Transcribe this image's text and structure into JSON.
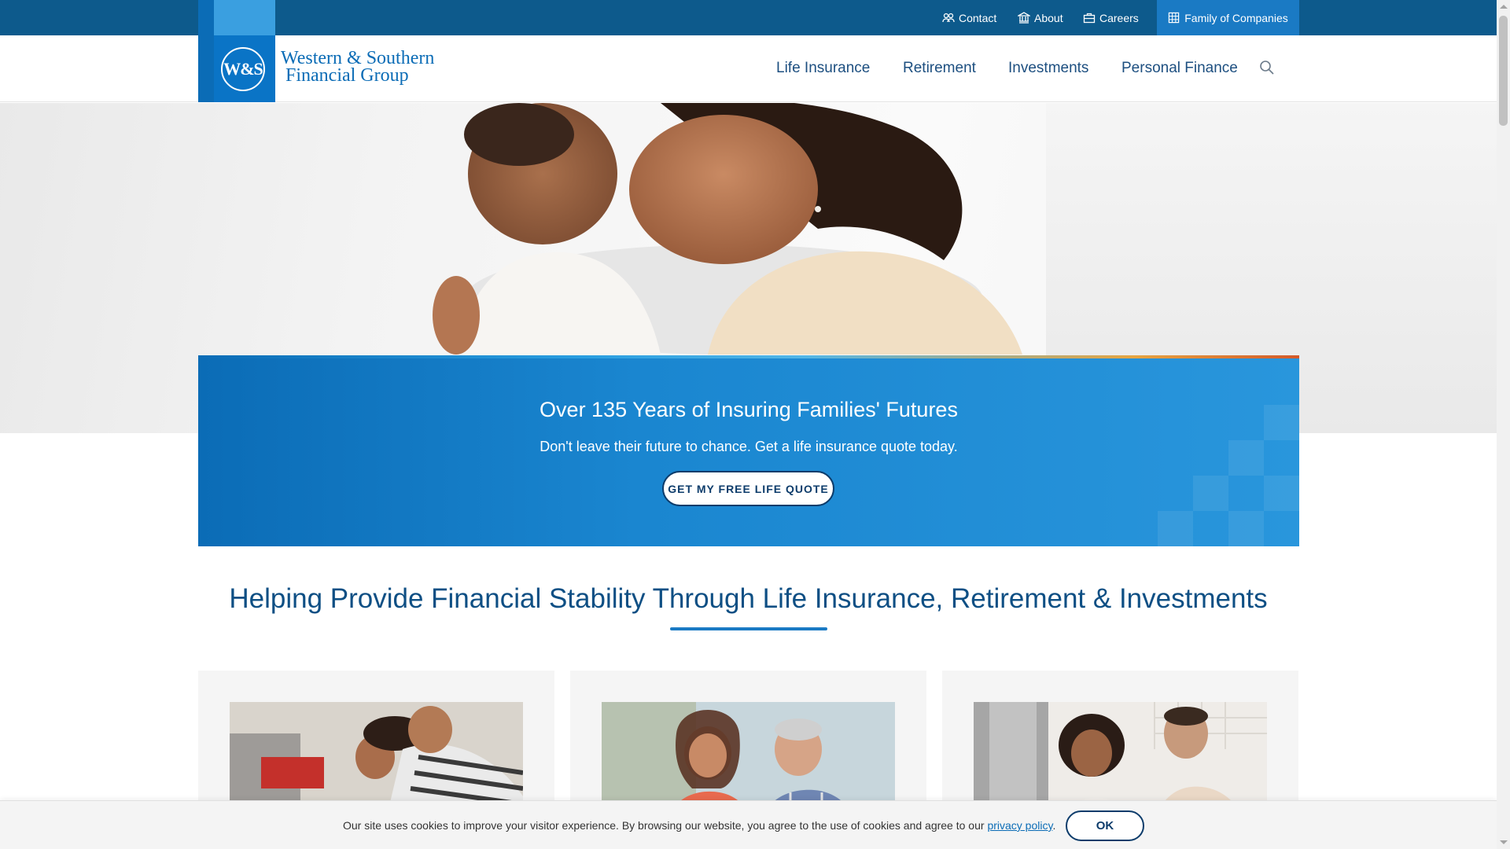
{
  "topbar": {
    "contact": "Contact",
    "about": "About",
    "careers": "Careers",
    "family": "Family of Companies"
  },
  "brand": {
    "logo_mark": "W&S",
    "line1": "Western & Southern",
    "line2": "Financial Group"
  },
  "nav": {
    "items": [
      "Life Insurance",
      "Retirement",
      "Investments",
      "Personal Finance"
    ]
  },
  "hero": {
    "title": "Over 135 Years of Insuring Families' Futures",
    "subtitle": "Don't leave their future to chance. Get a life insurance quote today.",
    "cta": "GET MY FREE LIFE QUOTE"
  },
  "section": {
    "headline": "Helping Provide Financial Stability Through Life Insurance, Retirement & Investments"
  },
  "cookie": {
    "message": "Our site uses cookies to improve your visitor experience. By browsing our website, you agree to the use of cookies and agree to our ",
    "link": "privacy policy",
    "end": ".",
    "ok": "OK"
  },
  "colors": {
    "topbar": "#0d5a8c",
    "brand_blue": "#0b6cb6",
    "headline": "#0e4f84",
    "button_navy": "#0d3c6b"
  },
  "icons": [
    "people-icon",
    "bank-icon",
    "briefcase-icon",
    "grid-icon",
    "search-icon"
  ]
}
